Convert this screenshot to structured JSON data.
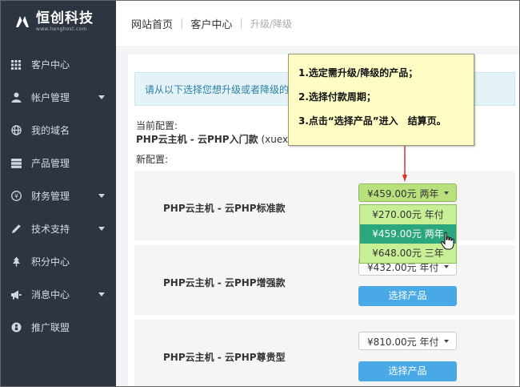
{
  "brand": {
    "title": "恒创科技",
    "subtitle": "www.henghost.com"
  },
  "sidebar": {
    "items": [
      {
        "label": "客户中心",
        "icon": "grid-icon",
        "has_caret": false
      },
      {
        "label": "帐户管理",
        "icon": "user-icon",
        "has_caret": true
      },
      {
        "label": "我的域名",
        "icon": "globe-icon",
        "has_caret": false
      },
      {
        "label": "产品管理",
        "icon": "server-icon",
        "has_caret": false
      },
      {
        "label": "财务管理",
        "icon": "yen-icon",
        "has_caret": true
      },
      {
        "label": "技术支持",
        "icon": "pencil-icon",
        "has_caret": true
      },
      {
        "label": "积分中心",
        "icon": "tree-icon",
        "has_caret": false
      },
      {
        "label": "消息中心",
        "icon": "megaphone-icon",
        "has_caret": true
      },
      {
        "label": "推广联盟",
        "icon": "badge-icon",
        "has_caret": false
      }
    ]
  },
  "breadcrumb": {
    "home": "网站首页",
    "center": "客户中心",
    "current": "升级/降级"
  },
  "main": {
    "info_text": "请从以下选择您想升级或者降级的",
    "current_label": "当前配置:",
    "current_product": "PHP云主机 - 云PHP入门款",
    "current_account": "(xuexic",
    "new_label": "新配置:",
    "products": [
      {
        "name": "PHP云主机 - 云PHP标准款",
        "selected": "¥459.00元 两年",
        "button": ""
      },
      {
        "name": "PHP云主机 - 云PHP增强款",
        "selected": "¥432.00元 年付",
        "button": "选择产品"
      },
      {
        "name": "PHP云主机 - 云PHP尊贵型",
        "selected": "¥810.00元 年付",
        "button": "选择产品"
      }
    ],
    "dropdown_options": [
      "¥270.00元 年付",
      "¥459.00元 两年",
      "¥648.00元 三年"
    ],
    "dropdown_highlight": "¥459.00元 两年"
  },
  "note": {
    "steps": [
      "1.选定需升级/降级的产品；",
      "2.选择付款周期；",
      "3.点击“选择产品”进入　结算页。"
    ]
  },
  "colors": {
    "sidebar": "#2d3540",
    "accent": "#48a9e6",
    "highlight": "#2ba77b",
    "dropdown": "#c8ef96",
    "note": "#fffdc4",
    "arrow": "#d9342b"
  }
}
